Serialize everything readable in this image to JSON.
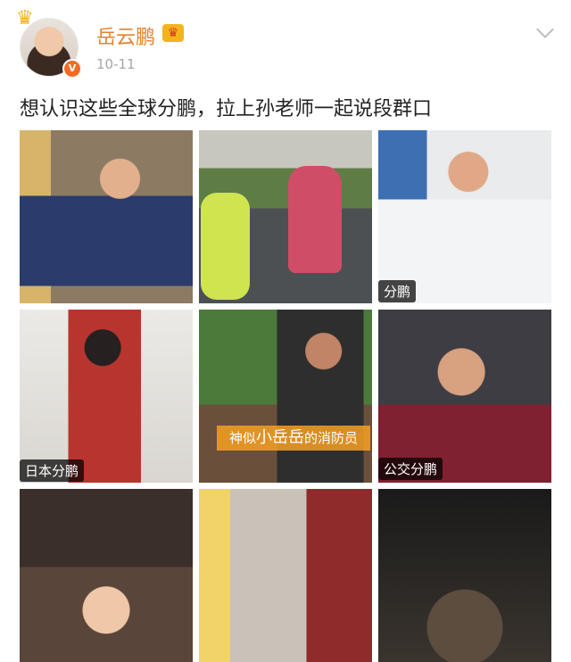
{
  "profile": {
    "name": "岳云鹏",
    "date": "10-11",
    "verified_badge": "V"
  },
  "post": {
    "text": "想认识这些全球分鹏，拉上孙老师一起说段群口"
  },
  "images": [
    {
      "label": ""
    },
    {
      "label": ""
    },
    {
      "label": "分鹏"
    },
    {
      "label": "日本分鹏"
    },
    {
      "label": "",
      "caption_prefix": "神似",
      "caption_highlight": "小岳岳",
      "caption_suffix": "的消防员"
    },
    {
      "label": "公交分鹏"
    },
    {
      "label": ""
    },
    {
      "label": ""
    },
    {
      "label": ""
    }
  ],
  "icons": {
    "crown_top": "crown-icon",
    "vip": "vip-crown-icon",
    "menu": "chevron-down-icon"
  },
  "colors": {
    "username": "#e5832b",
    "date": "#a6a6a6",
    "verified": "#f36c21"
  }
}
